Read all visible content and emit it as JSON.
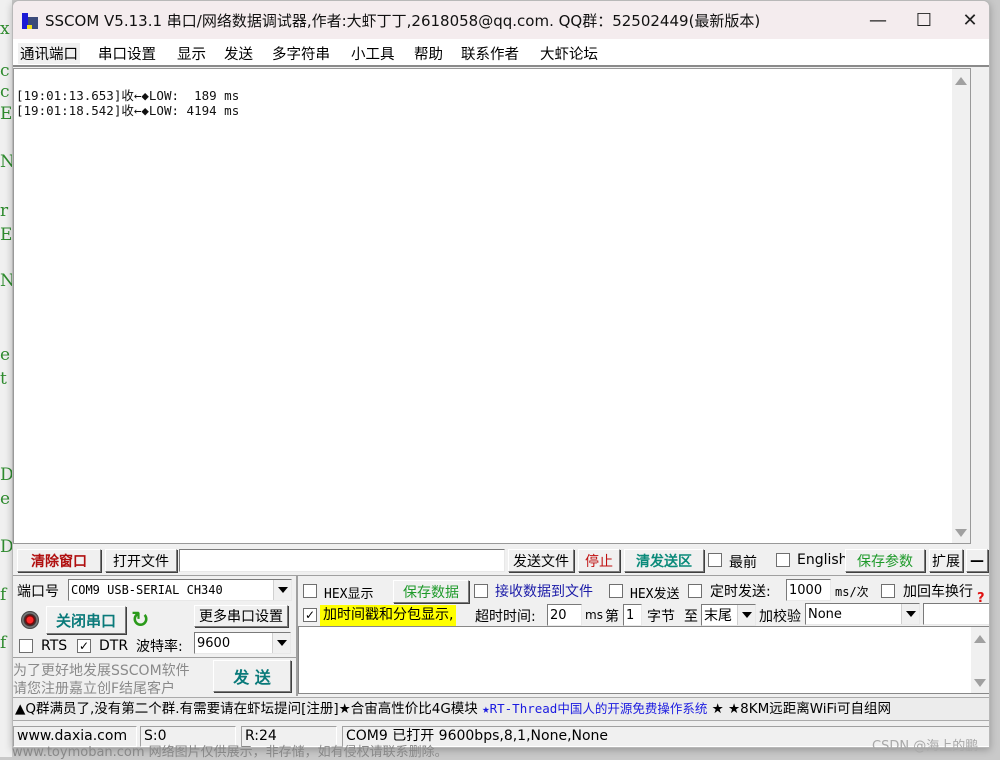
{
  "window": {
    "title": "SSCOM V5.13.1 串口/网络数据调试器,作者:大虾丁丁,2618058@qq.com. QQ群：52502449(最新版本)",
    "controls": {
      "minimize": "—",
      "maximize": "☐",
      "close": "✕"
    }
  },
  "menu": [
    "通讯端口",
    "串口设置",
    "显示",
    "发送",
    "多字符串",
    "小工具",
    "帮助",
    "联系作者",
    "大虾论坛"
  ],
  "receive": {
    "lines": [
      "[19:01:13.653]收←◆LOW:  189 ms",
      "[19:01:18.542]收←◆LOW: 4194 ms"
    ]
  },
  "toolbar": {
    "clear_window": "清除窗口",
    "open_file": "打开文件",
    "file_path": "",
    "send_file": "发送文件",
    "stop": "停止",
    "clear_send": "清发送区",
    "topmost_label": "最前",
    "english_label": "English",
    "save_params": "保存参数",
    "expand": "扩展",
    "collapse": "—"
  },
  "port": {
    "port_label": "端口号",
    "port_value": "COM9 USB-SERIAL CH340",
    "close_port": "关闭串口",
    "more_settings": "更多串口设置",
    "rts_label": "RTS",
    "dtr_label": "DTR",
    "baud_label": "波特率:",
    "baud_value": "9600",
    "promo_line1": "为了更好地发展SSCOM软件",
    "promo_line2": "请您注册嘉立创F结尾客户",
    "send_button": "发  送"
  },
  "options": {
    "hex_display": "HEX显示",
    "save_data": "保存数据",
    "recv_to_file": "接收数据到文件",
    "hex_send": "HEX发送",
    "timed_send": "定时发送:",
    "timed_interval": "1000",
    "interval_unit": "ms/次",
    "add_crlf": "加回车换行",
    "timestamp_label": "加时间戳和分包显示,",
    "timeout_label": "超时时间:",
    "timeout_value": "20",
    "timeout_unit": "ms",
    "byte_prefix": "第",
    "byte_start": "1",
    "byte_suffix": "字节",
    "to_label": "至",
    "to_value": "末尾",
    "checksum_label": "加校验",
    "checksum_value": "None",
    "help_icon": "?"
  },
  "send_text": "",
  "ticker": {
    "part1": "▲Q群满员了,没有第二个群.有需要请在虾坛提问[注册]★合宙高性价比4G模块 ",
    "part2": "★RT-Thread中国人的开源免费操作系统",
    "part3": " ★ ★8KM远距离WiFi可自组网"
  },
  "status": {
    "website": "www.daxia.com",
    "sent": "S:0",
    "received": "R:24",
    "port_status": "COM9 已打开  9600bps,8,1,None,None"
  },
  "watermarks": {
    "bottom": "www.toymoban.com 网络图片仅供展示，非存储，如有侵权请联系删除。",
    "csdn": "CSDN @海上的鹏"
  },
  "checkbox_states": {
    "hex_display": false,
    "recv_to_file": false,
    "hex_send": false,
    "timed_send": false,
    "add_crlf": false,
    "timestamp": true,
    "rts": false,
    "dtr": true,
    "topmost": false,
    "english": false
  },
  "colors": {
    "clear_window_text": "#b01010",
    "stop_text": "#c01010",
    "clear_send_text": "#0a8a7a",
    "save_green": "#1e9a2a",
    "link_blue": "#1c1ca8",
    "timestamp_highlight": "#ffff00",
    "close_port_text": "#0a7a7a"
  }
}
